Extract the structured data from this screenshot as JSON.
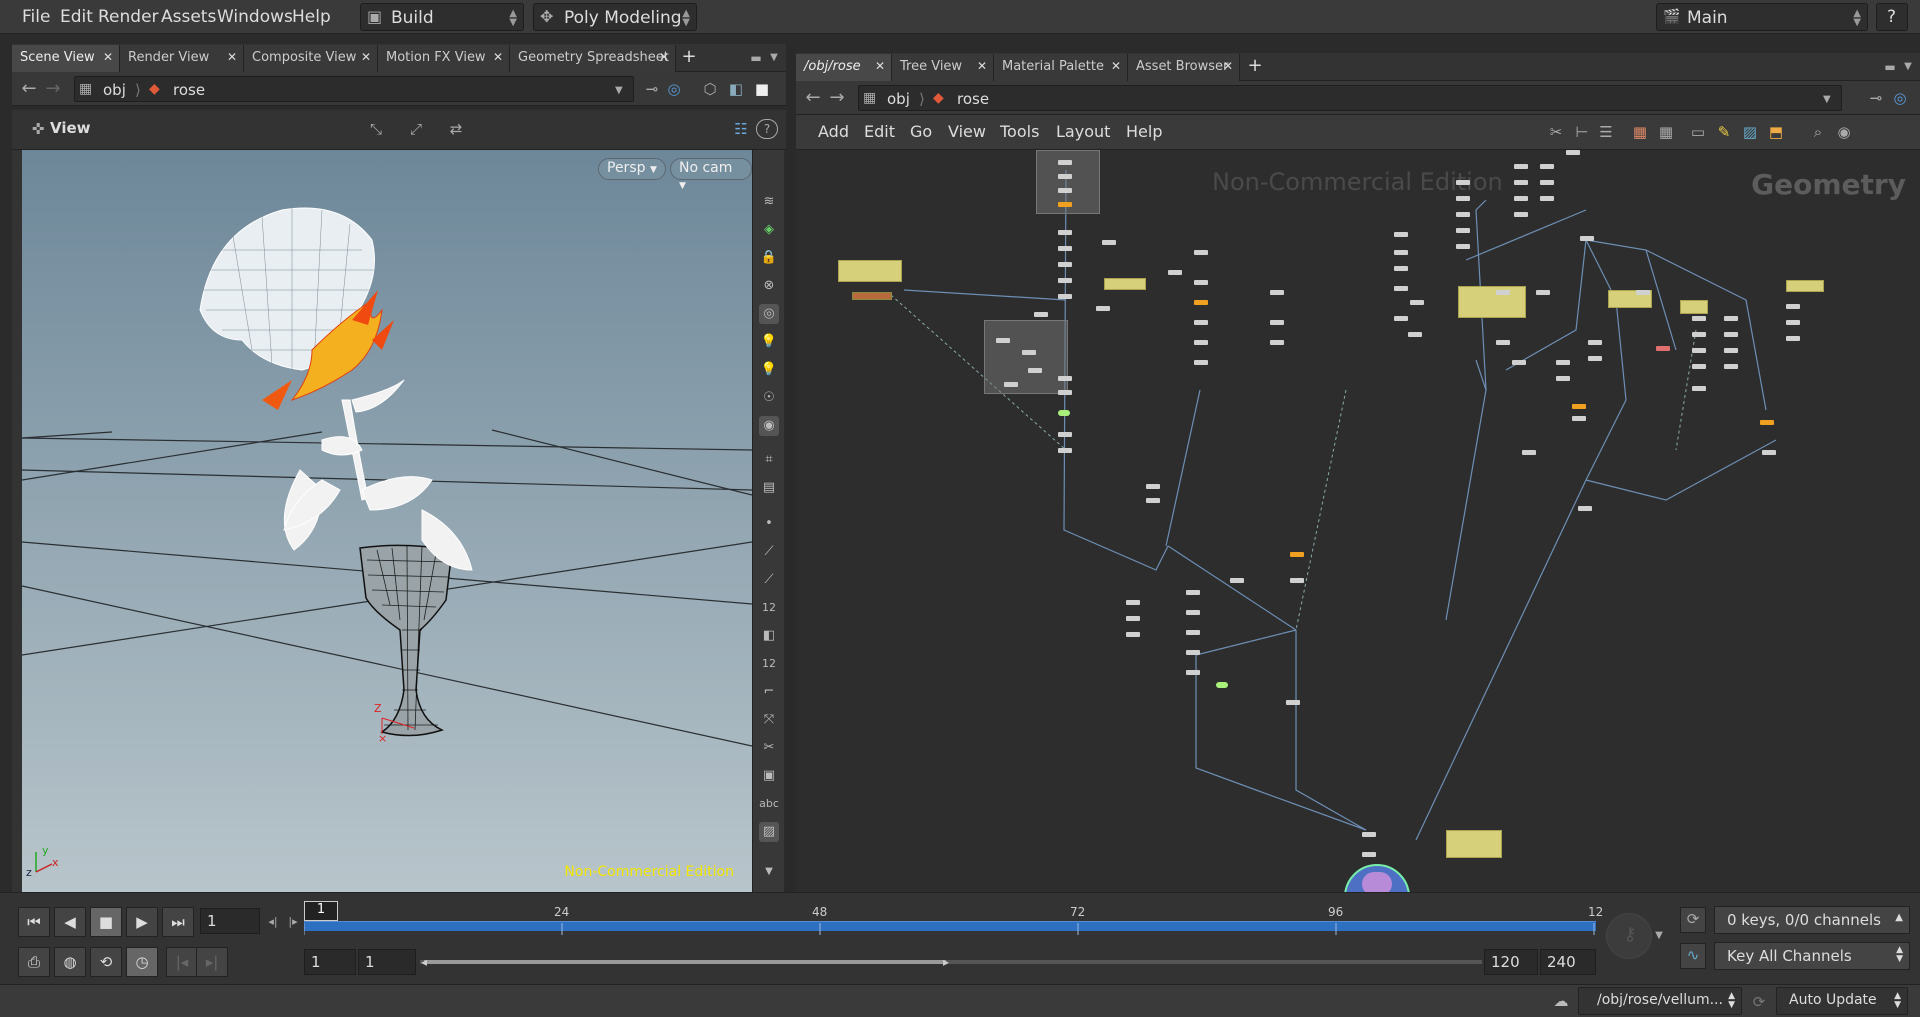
{
  "menubar": {
    "items": [
      "File",
      "Edit",
      "Render",
      "Assets",
      "Windows",
      "Help"
    ],
    "desktop_label": "Build",
    "shelf_label": "Poly Modeling",
    "context_label": "Main",
    "help_glyph": "?"
  },
  "left_pane": {
    "tabs": [
      "Scene View",
      "Render View",
      "Composite View",
      "Motion FX View",
      "Geometry Spreadsheet"
    ],
    "path": [
      "obj",
      "rose"
    ],
    "viewer_title": "View",
    "persp_label": "Persp",
    "cam_label": "No cam",
    "watermark": "Non-Commercial Edition",
    "axis_labels": {
      "x": "x",
      "y": "y",
      "z": "z",
      "gz": "Z"
    },
    "toolbar_text": {
      "num12a": "12",
      "num12b": "12",
      "abc": "abc"
    }
  },
  "right_pane": {
    "tabs": [
      "/obj/rose",
      "Tree View",
      "Material Palette",
      "Asset Browser"
    ],
    "path": [
      "obj",
      "rose"
    ],
    "menu": [
      "Add",
      "Edit",
      "Go",
      "View",
      "Tools",
      "Layout",
      "Help"
    ],
    "watermark": "Non-Commercial Edition",
    "context_label": "Geometry"
  },
  "timeline": {
    "current_frame": "1",
    "frame_marker": "1",
    "tick_labels": [
      "24",
      "48",
      "72",
      "96",
      "12"
    ],
    "range_start": "1",
    "range_start2": "1",
    "range_end": "120",
    "range_end2": "240",
    "keys_label": "0 keys, 0/0 channels",
    "key_all_label": "Key All Channels"
  },
  "status": {
    "path": "/obj/rose/vellum...",
    "update_mode": "Auto Update"
  },
  "colors": {
    "accent_blue": "#2d6fc0",
    "watermark_yellow": "#f3e600",
    "node_orange": "#f0a020",
    "note_yellow": "#d7d07a"
  }
}
